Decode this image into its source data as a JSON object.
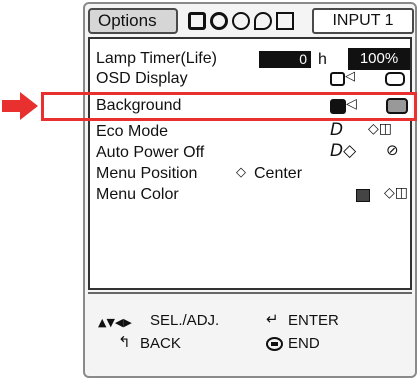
{
  "header": {
    "tab_options_label": "Options",
    "tab_input_label": "INPUT 1",
    "tab_icons": [
      "picture-tab-icon",
      "sync-tab-icon",
      "audio-tab-icon",
      "speech-tab-icon",
      "display-tab-icon"
    ]
  },
  "menu": {
    "items": [
      {
        "label": "Lamp Timer(Life)",
        "value": "0",
        "unit": "h",
        "extra": "100%"
      },
      {
        "label": "OSD Display"
      },
      {
        "label": "Background",
        "selected": true
      },
      {
        "label": "Eco Mode"
      },
      {
        "label": "Auto Power Off"
      },
      {
        "label": "Menu Position",
        "value": "Center"
      },
      {
        "label": "Menu Color"
      }
    ]
  },
  "footer": {
    "sel_adj": "SEL./ADJ.",
    "enter": "ENTER",
    "back": "BACK",
    "end": "END"
  },
  "colors": {
    "highlight": "#e8302f",
    "panel_border": "#8a8a8a",
    "selected_row": "#ffffff"
  }
}
